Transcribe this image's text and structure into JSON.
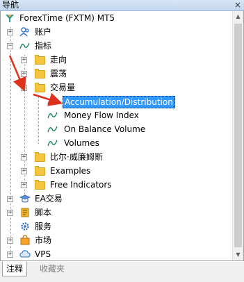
{
  "window": {
    "title": "导航",
    "close": "×"
  },
  "tree": {
    "root": "ForexTime (FXTM) MT5",
    "accounts": "账户",
    "indicators": "指标",
    "trend": "走向",
    "oscillators": "震荡",
    "volumes_folder": "交易量",
    "volume_items": [
      "Accumulation/Distribution",
      "Money Flow Index",
      "On Balance Volume",
      "Volumes"
    ],
    "bill_williams": "比尔·威廉姆斯",
    "examples": "Examples",
    "free_indicators": "Free Indicators",
    "ea": "EA交易",
    "scripts": "脚本",
    "services": "服务",
    "market": "市场",
    "vps": "VPS"
  },
  "tabs": {
    "common": "注释",
    "favorites": "收藏夹"
  },
  "colors": {
    "selection": "#3399ff",
    "arrow": "#e0301e",
    "folder": "#f5c542"
  }
}
